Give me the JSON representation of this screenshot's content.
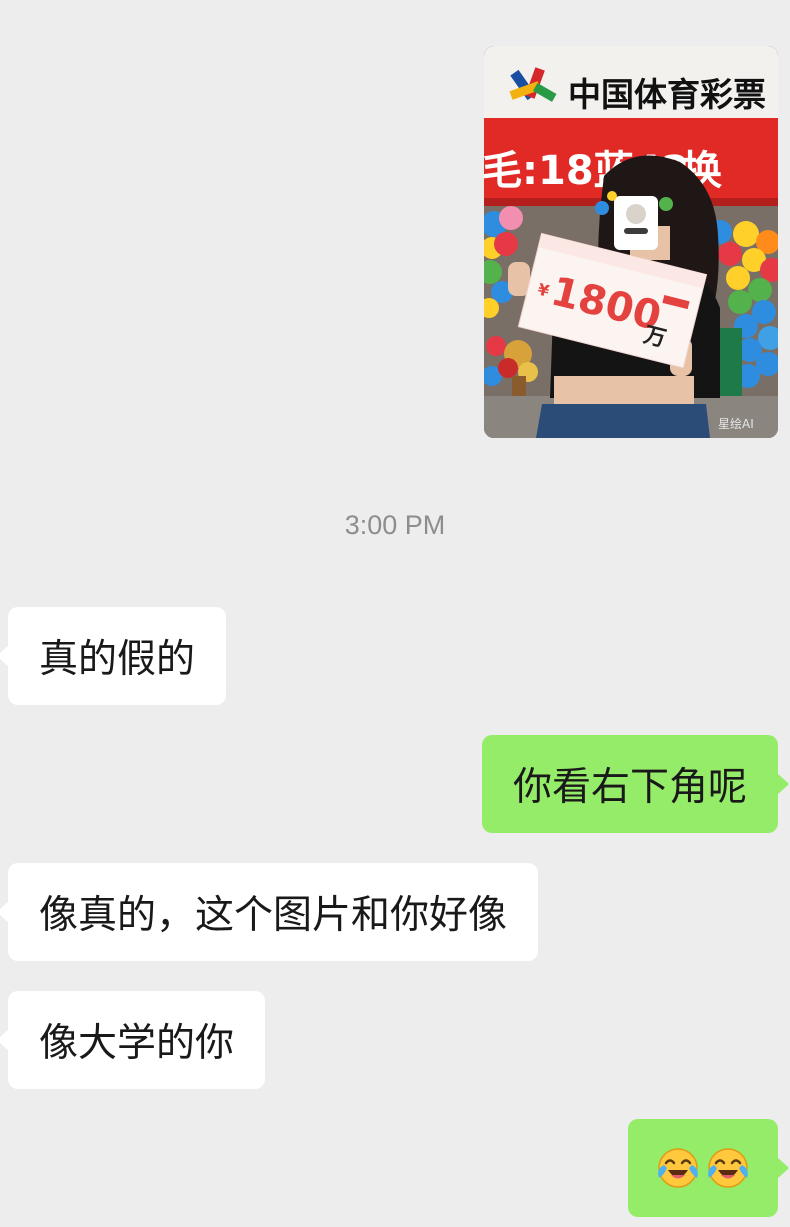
{
  "chat": {
    "image_message": {
      "shop_sign": "中国体育彩票",
      "banner_text": "毛:18蓝42",
      "banner_tail": "换",
      "ticket_amount": "1800",
      "ticket_unit": "万",
      "ticket_currency": "¥",
      "watermark": "星绘AI"
    },
    "timestamp": "3:00 PM",
    "messages": [
      {
        "side": "in",
        "text": "真的假的"
      },
      {
        "side": "out",
        "text": "你看右下角呢"
      },
      {
        "side": "in",
        "text": "像真的，这个图片和你好像"
      },
      {
        "side": "in",
        "text": "像大学的你"
      },
      {
        "side": "out",
        "emojis": [
          "face-with-tears-of-joy-icon",
          "face-with-tears-of-joy-icon"
        ]
      }
    ]
  },
  "colors": {
    "background": "#ededed",
    "incoming_bubble": "#ffffff",
    "outgoing_bubble": "#95ec69",
    "timestamp_text": "#8d8d8d",
    "message_text": "#191919"
  }
}
